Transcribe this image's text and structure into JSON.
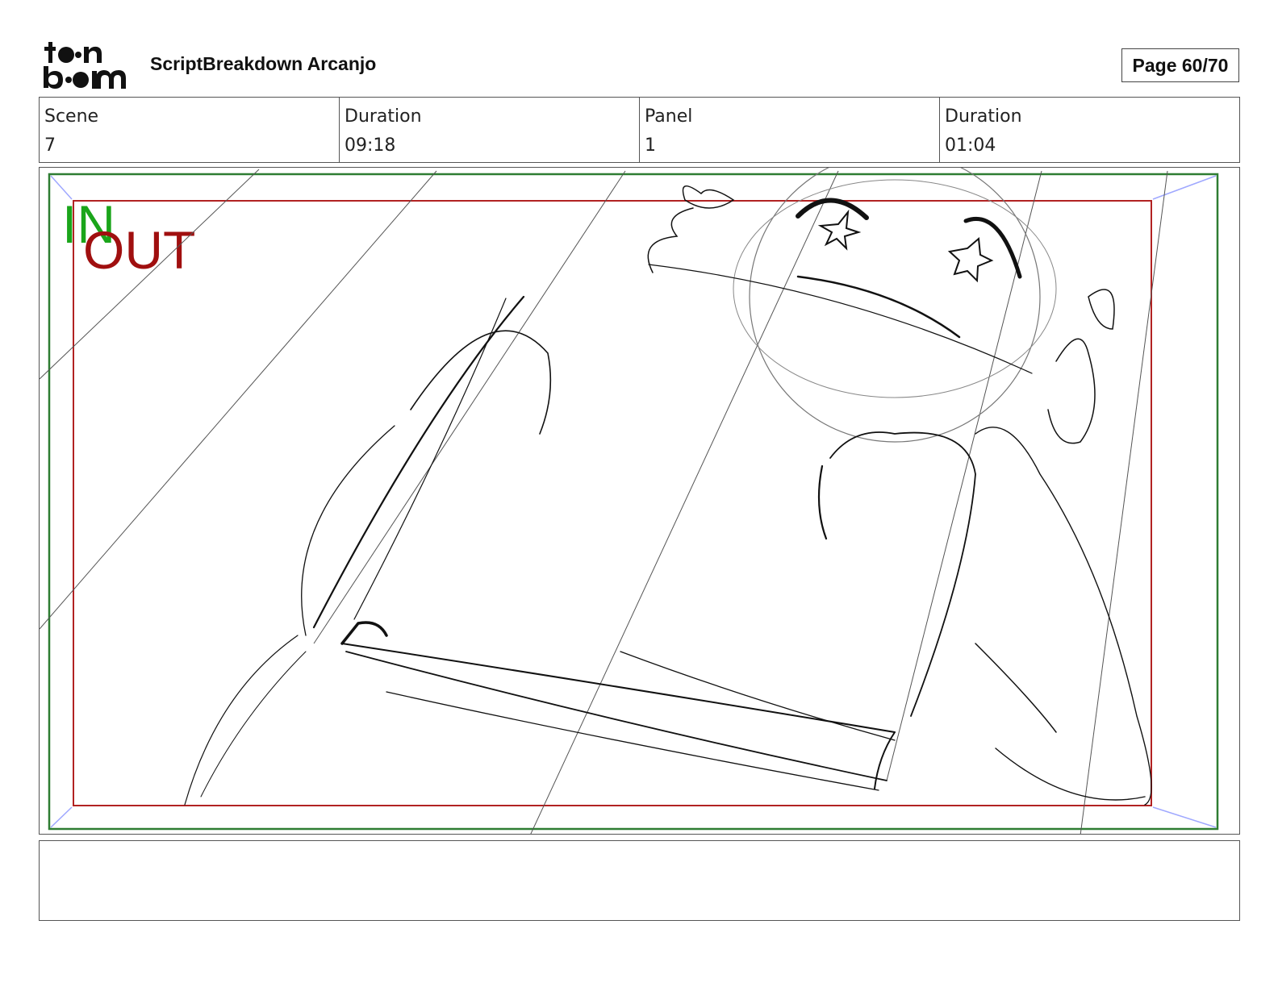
{
  "header": {
    "logo_text": "toonboom",
    "title": "ScriptBreakdown Arcanjo",
    "page_label": "Page 60/70"
  },
  "info": {
    "scene_label": "Scene",
    "scene_value": "7",
    "duration_label": "Duration",
    "duration_value": "09:18",
    "panel_label": "Panel",
    "panel_value": "1",
    "panel_duration_label": "Duration",
    "panel_duration_value": "01:04"
  },
  "panel": {
    "in_label": "IN",
    "out_label": "OUT",
    "in_color": "#1aa51a",
    "out_color": "#a00f0f"
  },
  "notes": {
    "text": ""
  }
}
